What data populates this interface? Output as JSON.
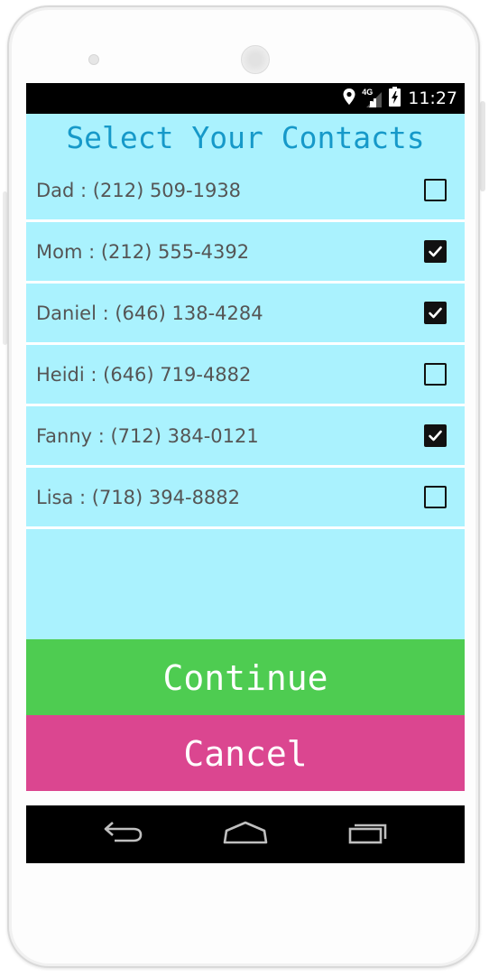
{
  "status_bar": {
    "time": "11:27",
    "network_label": "4G",
    "icons": [
      "location-icon",
      "signal-icon",
      "battery-charging-icon"
    ]
  },
  "title": "Select Your Contacts",
  "contacts": [
    {
      "label": "Dad : (212) 509-1938",
      "checked": false
    },
    {
      "label": "Mom : (212) 555-4392",
      "checked": true
    },
    {
      "label": "Daniel : (646) 138-4284",
      "checked": true
    },
    {
      "label": "Heidi : (646) 719-4882",
      "checked": false
    },
    {
      "label": "Fanny : (712) 384-0121",
      "checked": true
    },
    {
      "label": "Lisa : (718) 394-8882",
      "checked": false
    }
  ],
  "buttons": {
    "continue_label": "Continue",
    "cancel_label": "Cancel"
  },
  "nav": {
    "icons": [
      "back-icon",
      "home-icon",
      "recent-apps-icon"
    ]
  },
  "colors": {
    "screen_background": "#aaf2fe",
    "title_text": "#1699c9",
    "continue_button": "#4ecc51",
    "cancel_button": "#db4690",
    "bars": "#000000"
  }
}
